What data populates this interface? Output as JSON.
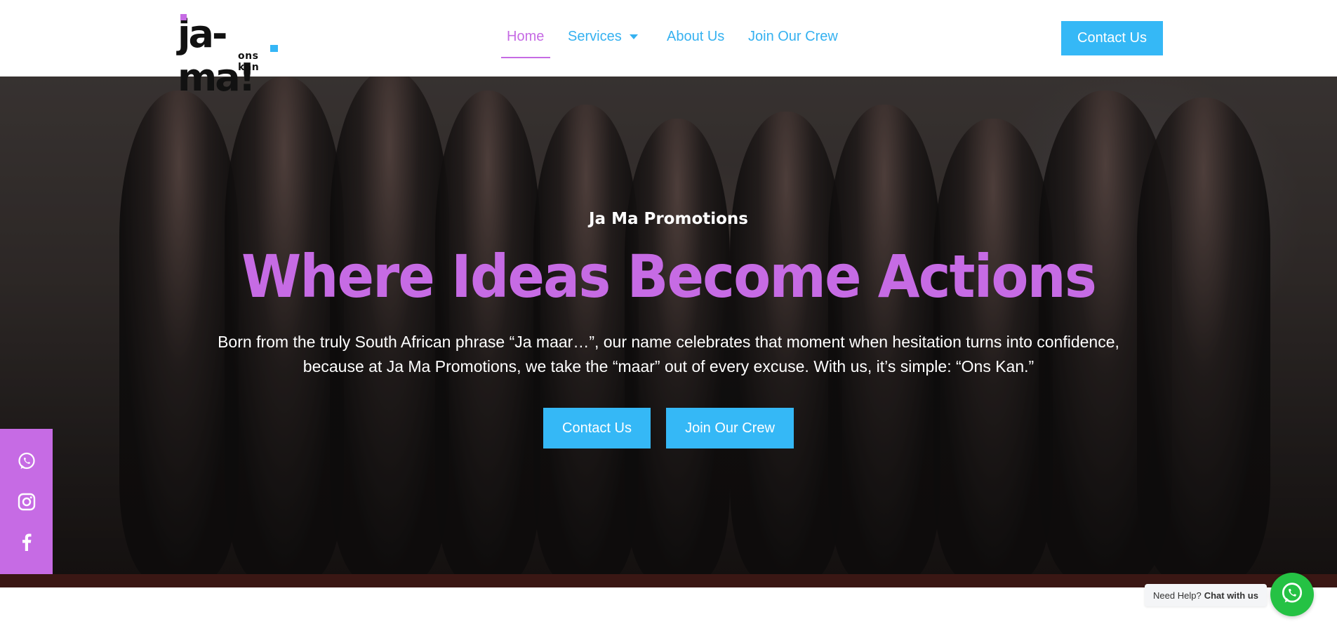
{
  "logo": {
    "main": "ja-ma!",
    "sub": "ons kan"
  },
  "nav": {
    "items": [
      {
        "label": "Home",
        "active": true
      },
      {
        "label": "Services",
        "has_dropdown": true
      },
      {
        "label": "About Us"
      },
      {
        "label": "Join Our Crew"
      }
    ],
    "cta": "Contact Us"
  },
  "hero": {
    "kicker": "Ja Ma Promotions",
    "title": "Where Ideas Become Actions",
    "text_line1": "Born from the truly South African phrase “Ja maar…”, our name celebrates that moment when hesitation turns into confidence,",
    "text_line2": "because at Ja Ma Promotions, we take the “maar” out of every excuse. With us, it’s simple: “Ons Kan.”",
    "buttons": [
      "Contact Us",
      "Join Our Crew"
    ]
  },
  "social": [
    "whatsapp-icon",
    "instagram-icon",
    "facebook-icon"
  ],
  "chat": {
    "prefix": "Need Help?",
    "action": "Chat with us"
  },
  "colors": {
    "accent_purple": "#c66be4",
    "accent_blue": "#35b8f6",
    "whatsapp_green": "#25c244"
  }
}
